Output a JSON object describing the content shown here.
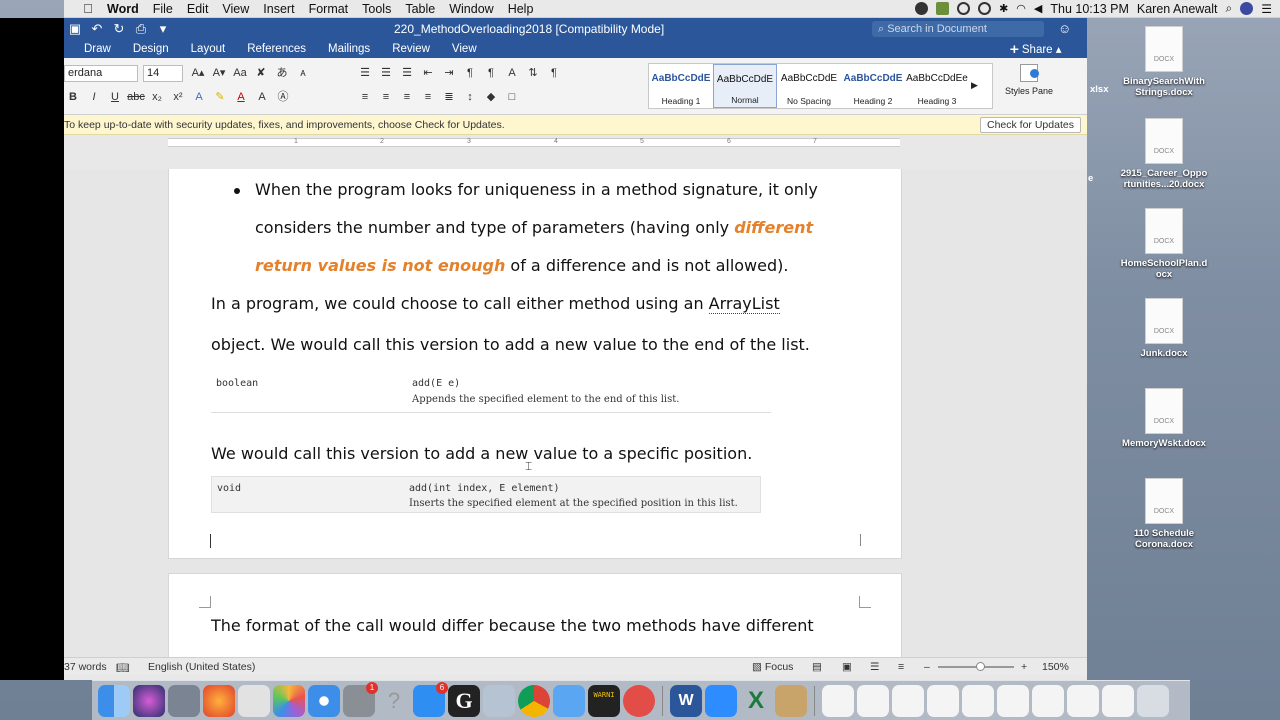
{
  "menubar": {
    "app_name": "Word",
    "items": [
      "File",
      "Edit",
      "View",
      "Insert",
      "Format",
      "Tools",
      "Table",
      "Window",
      "Help"
    ],
    "clock": "Thu 10:13 PM",
    "user": "Karen Anewalt"
  },
  "titlebar": {
    "title": "220_MethodOverloading2018 [Compatibility Mode]",
    "search_placeholder": "Search in Document"
  },
  "tabs": [
    "Draw",
    "Design",
    "Layout",
    "References",
    "Mailings",
    "Review",
    "View"
  ],
  "share_label": "Share",
  "ribbon": {
    "font_name": "erdana",
    "font_size": "14",
    "styles": [
      {
        "preview": "AaBbCcDdE",
        "name": "Heading 1"
      },
      {
        "preview": "AaBbCcDdE",
        "name": "Normal"
      },
      {
        "preview": "AaBbCcDdE",
        "name": "No Spacing"
      },
      {
        "preview": "AaBbCcDdE",
        "name": "Heading 2"
      },
      {
        "preview": "AaBbCcDdEe",
        "name": "Heading 3"
      }
    ],
    "styles_pane_label": "Styles Pane"
  },
  "message_bar": {
    "text": "To keep up-to-date with security updates, fixes, and improvements, choose Check for Updates.",
    "button": "Check for Updates"
  },
  "ruler_numbers": [
    "1",
    "2",
    "3",
    "4",
    "5",
    "6",
    "7"
  ],
  "document": {
    "bullet_line1": "When the program looks for uniqueness in a method signature, it only",
    "bullet_line2_pre": "considers the number and type of parameters (having only ",
    "bullet_line2_emph": "different",
    "bullet_line3_emph": "return values is not enough",
    "bullet_line3_post": " of a difference and is not allowed).",
    "para1_line1_pre": "In a program, we could choose to call either method using an ",
    "para1_line1_word": "ArrayList",
    "para1_line2": "object.  We would call this version to add a new value to the end of the list.",
    "api1": {
      "type": "boolean",
      "method": "add(E e)",
      "desc": "Appends the specified element to the end of this list."
    },
    "para2": "We would call this version to add a new value to a specific position.",
    "api2": {
      "type": "void",
      "method": "add(int index, E element)",
      "desc": "Inserts the specified element at the specified position in this list."
    },
    "page2_line1": "The format of the call would differ because the two methods have different"
  },
  "statusbar": {
    "words": "37 words",
    "language": "English (United States)",
    "focus": "Focus",
    "zoom": "150%"
  },
  "desktop_icons": [
    {
      "label": "BinarySearchWith Strings.docx"
    },
    {
      "label": "2915_Career_Oppo rtunities...20.docx"
    },
    {
      "label": "HomeSchoolPlan.d ocx"
    },
    {
      "label": "Junk.docx"
    },
    {
      "label": "MemoryWskt.docx"
    },
    {
      "label": "110 Schedule Corona.docx"
    }
  ],
  "desktop_partial_labels": [
    "xlsx",
    "e"
  ],
  "dock": {
    "mail_badge": "6",
    "settings_badge": "1",
    "console_label": "WARNI"
  }
}
